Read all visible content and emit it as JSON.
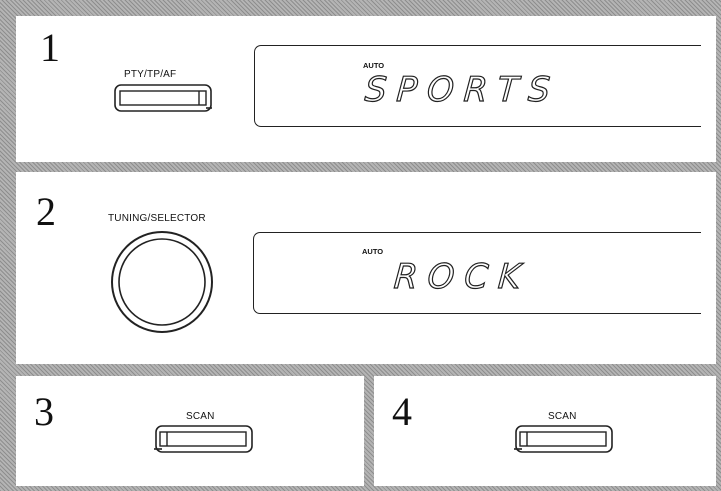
{
  "steps": [
    {
      "number": "1",
      "button_label": "PTY/TP/AF",
      "display_mode": "AUTO",
      "display_text": "SPORTS"
    },
    {
      "number": "2",
      "knob_label": "TUNING/SELECTOR",
      "display_mode": "AUTO",
      "display_text": "ROCK"
    },
    {
      "number": "3",
      "button_label": "SCAN"
    },
    {
      "number": "4",
      "button_label": "SCAN"
    }
  ]
}
